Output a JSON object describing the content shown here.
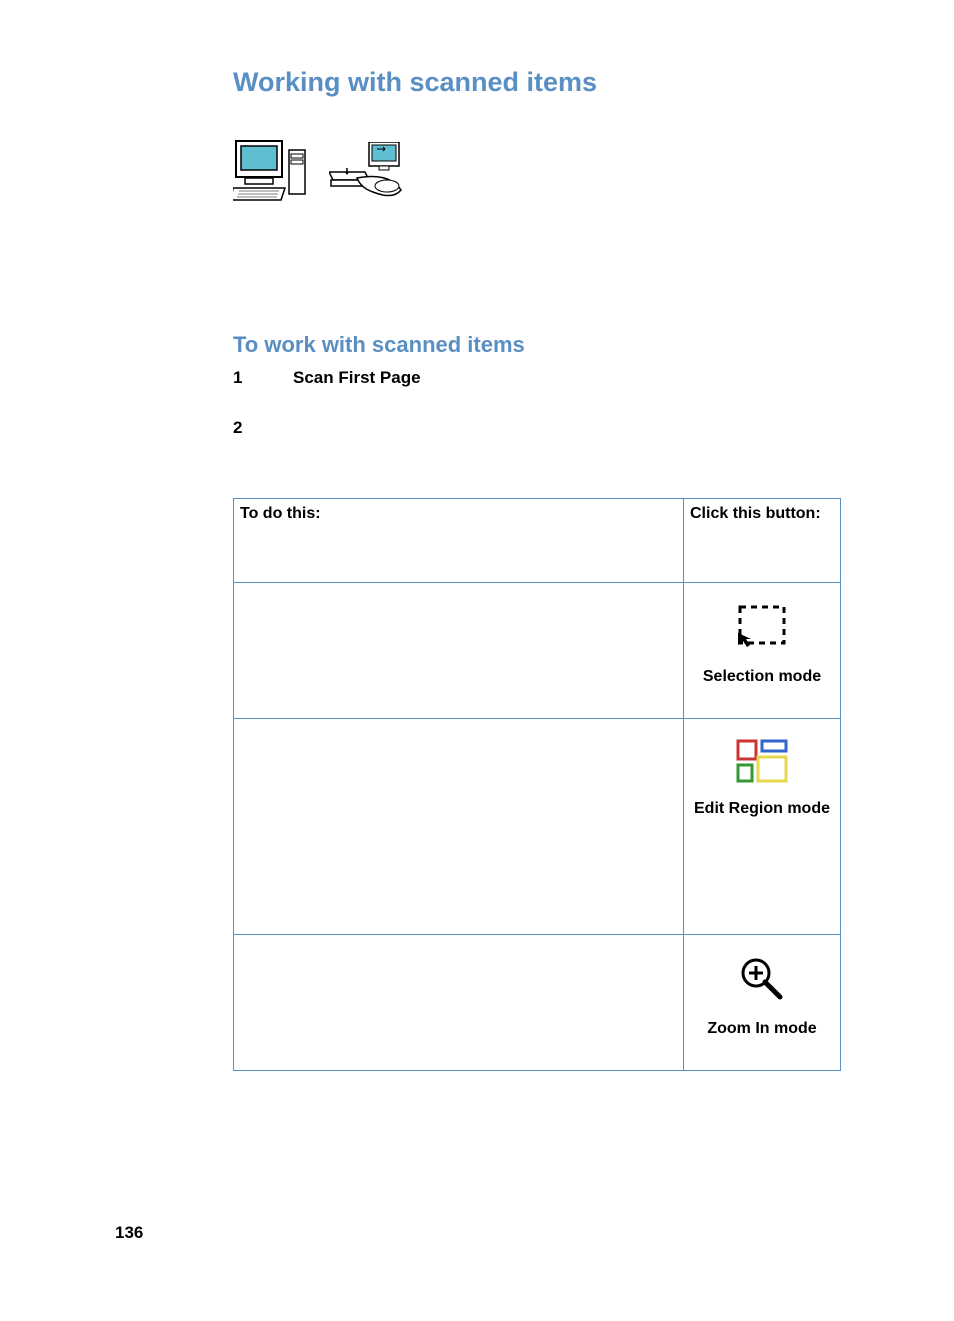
{
  "title": "Working with scanned items",
  "subtitle": "To work with scanned items",
  "steps": [
    {
      "num": "1",
      "text": "Scan First Page"
    },
    {
      "num": "2",
      "text": ""
    }
  ],
  "table": {
    "header": {
      "col1": "To do this:",
      "col2": "Click this button:"
    },
    "rows": [
      {
        "desc": "",
        "icon": "selection-mode-icon",
        "label": "Selection mode"
      },
      {
        "desc": "",
        "icon": "edit-region-mode-icon",
        "label": "Edit Region mode"
      },
      {
        "desc": "",
        "icon": "zoom-in-mode-icon",
        "label": "Zoom In mode"
      }
    ]
  },
  "page_number": "136"
}
